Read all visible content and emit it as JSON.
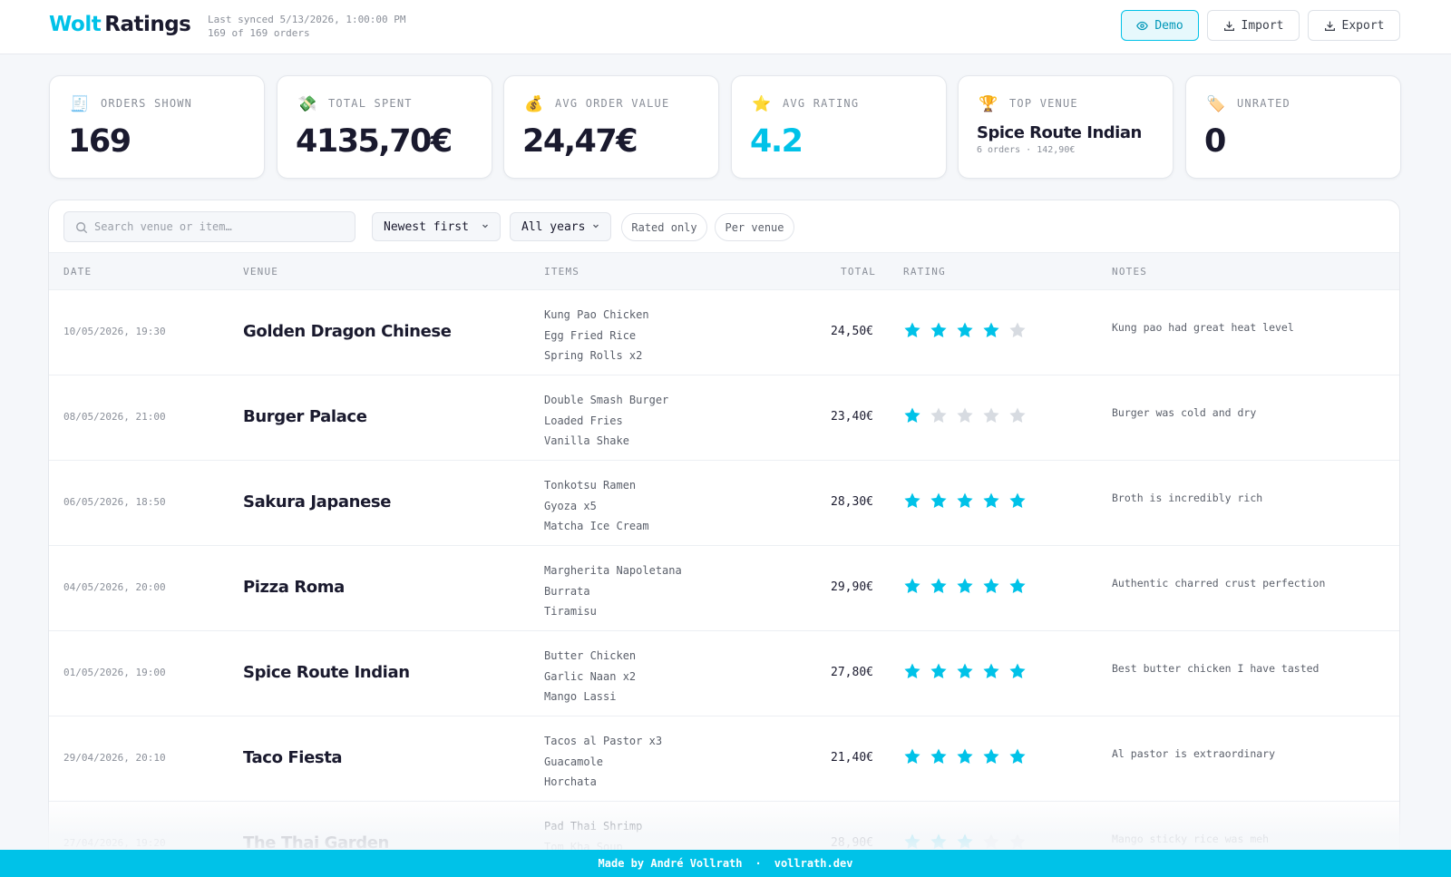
{
  "header": {
    "logo_brand": "Wolt",
    "logo_product": "Ratings",
    "sync_line": "Last synced 5/13/2026, 1:00:00 PM",
    "orders_line": "169 of 169 orders",
    "demo_label": "Demo",
    "import_label": "Import",
    "export_label": "Export"
  },
  "stats": {
    "orders_shown": {
      "icon": "receipt-icon",
      "label": "ORDERS SHOWN",
      "value": "169"
    },
    "total_spent": {
      "icon": "money-icon",
      "label": "TOTAL SPENT",
      "value": "4135,70€"
    },
    "avg_order_value": {
      "icon": "money-bag-icon",
      "label": "AVG ORDER VALUE",
      "value": "24,47€"
    },
    "avg_rating": {
      "icon": "star-icon",
      "label": "AVG RATING",
      "value": "4.2"
    },
    "top_venue": {
      "icon": "trophy-icon",
      "label": "TOP VENUE",
      "value": "Spice Route Indian",
      "sub": "6 orders · 142,90€"
    },
    "unrated": {
      "icon": "tag-icon",
      "label": "UNRATED",
      "value": "0"
    }
  },
  "filters": {
    "search_placeholder": "Search venue or item…",
    "sort": "Newest first",
    "years": "All years",
    "rated_only": "Rated only",
    "per_venue": "Per venue"
  },
  "table": {
    "columns": {
      "date": "DATE",
      "venue": "VENUE",
      "items": "ITEMS",
      "total": "TOTAL",
      "rating": "RATING",
      "notes": "NOTES"
    },
    "rows": [
      {
        "date": "10/05/2026, 19:30",
        "venue": "Golden Dragon Chinese",
        "items": [
          "Kung Pao Chicken",
          "Egg Fried Rice",
          "Spring Rolls x2"
        ],
        "total": "24,50€",
        "rating": 4,
        "note": "Kung pao had great heat level"
      },
      {
        "date": "08/05/2026, 21:00",
        "venue": "Burger Palace",
        "items": [
          "Double Smash Burger",
          "Loaded Fries",
          "Vanilla Shake"
        ],
        "total": "23,40€",
        "rating": 1,
        "note": "Burger was cold and dry"
      },
      {
        "date": "06/05/2026, 18:50",
        "venue": "Sakura Japanese",
        "items": [
          "Tonkotsu Ramen",
          "Gyoza x5",
          "Matcha Ice Cream"
        ],
        "total": "28,30€",
        "rating": 5,
        "note": "Broth is incredibly rich"
      },
      {
        "date": "04/05/2026, 20:00",
        "venue": "Pizza Roma",
        "items": [
          "Margherita Napoletana",
          "Burrata",
          "Tiramisu"
        ],
        "total": "29,90€",
        "rating": 5,
        "note": "Authentic charred crust perfection"
      },
      {
        "date": "01/05/2026, 19:00",
        "venue": "Spice Route Indian",
        "items": [
          "Butter Chicken",
          "Garlic Naan x2",
          "Mango Lassi"
        ],
        "total": "27,80€",
        "rating": 5,
        "note": "Best butter chicken I have tasted"
      },
      {
        "date": "29/04/2026, 20:10",
        "venue": "Taco Fiesta",
        "items": [
          "Tacos al Pastor x3",
          "Guacamole",
          "Horchata"
        ],
        "total": "21,40€",
        "rating": 5,
        "note": "Al pastor is extraordinary"
      },
      {
        "date": "27/04/2026, 19:20",
        "venue": "The Thai Garden",
        "items": [
          "Pad Thai Shrimp",
          "Tom Kha Soup",
          ""
        ],
        "total": "28,90€",
        "rating": 3,
        "note": "Mango sticky rice was meh"
      }
    ]
  },
  "footer": {
    "made_by": "Made by André Vollrath",
    "separator": "·",
    "site": "vollrath.dev"
  },
  "colors": {
    "accent": "#00c2e8",
    "star_empty": "#d7dbe1",
    "text": "#1a1a2e"
  }
}
